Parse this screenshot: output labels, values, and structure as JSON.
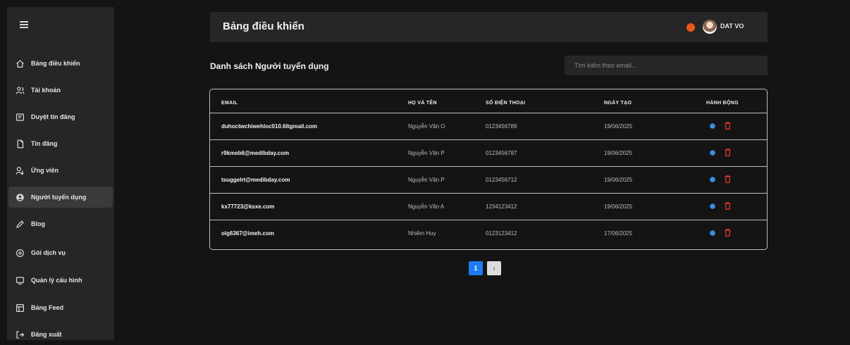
{
  "sidebar": {
    "items": [
      {
        "label": "Bảng điều khiển",
        "icon": "home-icon",
        "active": false
      },
      {
        "label": "Tài khoản",
        "icon": "users-icon",
        "active": false
      },
      {
        "label": "Duyệt tin đăng",
        "icon": "review-posts-icon",
        "active": false
      },
      {
        "label": "Tin đăng",
        "icon": "document-icon",
        "active": false
      },
      {
        "label": "Ứng viên",
        "icon": "candidate-icon",
        "active": false
      },
      {
        "label": "Người tuyển dụng",
        "icon": "recruiter-icon",
        "active": true
      },
      {
        "label": "Blog",
        "icon": "pen-icon",
        "active": false
      },
      {
        "label": "Gói dịch vụ",
        "icon": "service-package-icon",
        "active": false
      },
      {
        "label": "Quản lý cấu hình",
        "icon": "settings-panel-icon",
        "active": false
      },
      {
        "label": "Bảng Feed",
        "icon": "feed-icon",
        "active": false
      },
      {
        "label": "Đăng xuất",
        "icon": "logout-icon",
        "active": false
      }
    ]
  },
  "header": {
    "title": "Bảng điều khiển",
    "user_name": "DAT VO"
  },
  "main": {
    "section_title": "Danh sách Người tuyển dụng",
    "search_placeholder": "Tìm kiếm theo email..."
  },
  "table": {
    "columns": [
      "EMAIL",
      "HỌ VÀ TÊN",
      "SỐ ĐIỆN THOẠI",
      "NGÀY TẠO",
      "HÀNH ĐỘNG"
    ],
    "rows": [
      {
        "email": "duhoctwchiwehloc010.6ltgmail.com",
        "name": "Nguyễn Văn O",
        "phone": "0123456789",
        "date": "19/06/2025"
      },
      {
        "email": "r9kmeb6@medibday.com",
        "name": "Nguyễn Văn P",
        "phone": "0123456787",
        "date": "19/06/2025"
      },
      {
        "email": "tsuggelrt@medibday.com",
        "name": "Nguyễn Văn P",
        "phone": "0123456712",
        "date": "19/06/2025"
      },
      {
        "email": "kx77723@ksxe.com",
        "name": "Nguyễn Văn A",
        "phone": "1234123412",
        "date": "19/06/2025"
      },
      {
        "email": "olg6367@imeh.com",
        "name": "Nhiêm Huy",
        "phone": "0123123412",
        "date": "17/06/2025"
      }
    ]
  },
  "pagination": {
    "current": "1",
    "next": "›"
  },
  "colors": {
    "accent": "#1e7cf2",
    "notification": "#e8571c",
    "view_icon": "#3b8ee8",
    "delete_icon": "#e0342f"
  }
}
